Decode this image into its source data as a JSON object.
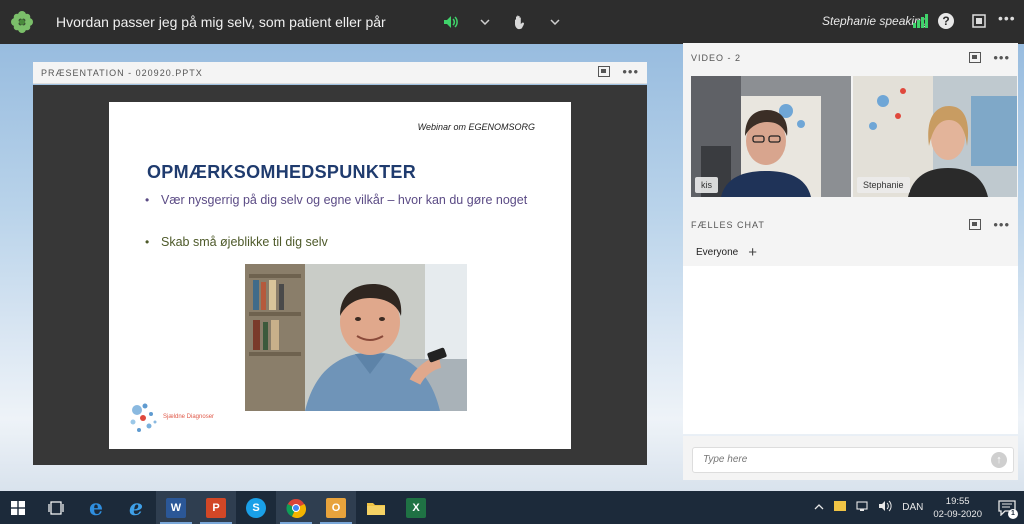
{
  "topbar": {
    "meeting_title": "Hvordan passer jeg på mig selv, som patient eller pårø...",
    "speaking_status": "Stephanie speaking",
    "help_label": "?",
    "more_label": "•••"
  },
  "presentation": {
    "pod_title": "PRÆSENTATION - 020920.PPTX",
    "more_label": "•••",
    "slide": {
      "header_note": "Webinar om EGENOMSORG",
      "heading": "OPMÆRKSOMHEDSPUNKTER",
      "bullets": [
        "Vær nysgerrig på dig selv og egne vilkår – hvor kan du gøre noget",
        "Skab små øjeblikke til dig selv"
      ],
      "bullet_symbol": "•",
      "logo_text": "Sjældne Diagnoser"
    }
  },
  "video_pod": {
    "title": "VIDEO - 2",
    "more_label": "•••",
    "participants": [
      {
        "name": "kis"
      },
      {
        "name": "Stephanie"
      }
    ]
  },
  "chat_pod": {
    "title": "FÆLLES CHAT",
    "more_label": "•••",
    "tab_label": "Everyone",
    "add_label": "+",
    "input_placeholder": "Type here",
    "send_label": "↑"
  },
  "taskbar": {
    "apps": [
      {
        "name": "task-view",
        "label": ""
      },
      {
        "name": "edge",
        "label": "e"
      },
      {
        "name": "internet-explorer",
        "label": "e"
      },
      {
        "name": "word",
        "label": "W"
      },
      {
        "name": "powerpoint",
        "label": "P"
      },
      {
        "name": "skype",
        "label": "S"
      },
      {
        "name": "chrome",
        "label": ""
      },
      {
        "name": "outlook",
        "label": "O"
      },
      {
        "name": "file-explorer",
        "label": ""
      },
      {
        "name": "excel",
        "label": "X"
      }
    ],
    "language": "DAN",
    "time": "19:55",
    "date": "02-09-2020",
    "notification_count": "1"
  },
  "colors": {
    "topbar_bg": "#2d2d2d",
    "speaker_green": "#3fd36a",
    "slide_heading": "#1f3b6e",
    "bullet1": "#5b4b85",
    "bullet2": "#4e5a2a",
    "taskbar_bg": "#1c2a3a"
  }
}
